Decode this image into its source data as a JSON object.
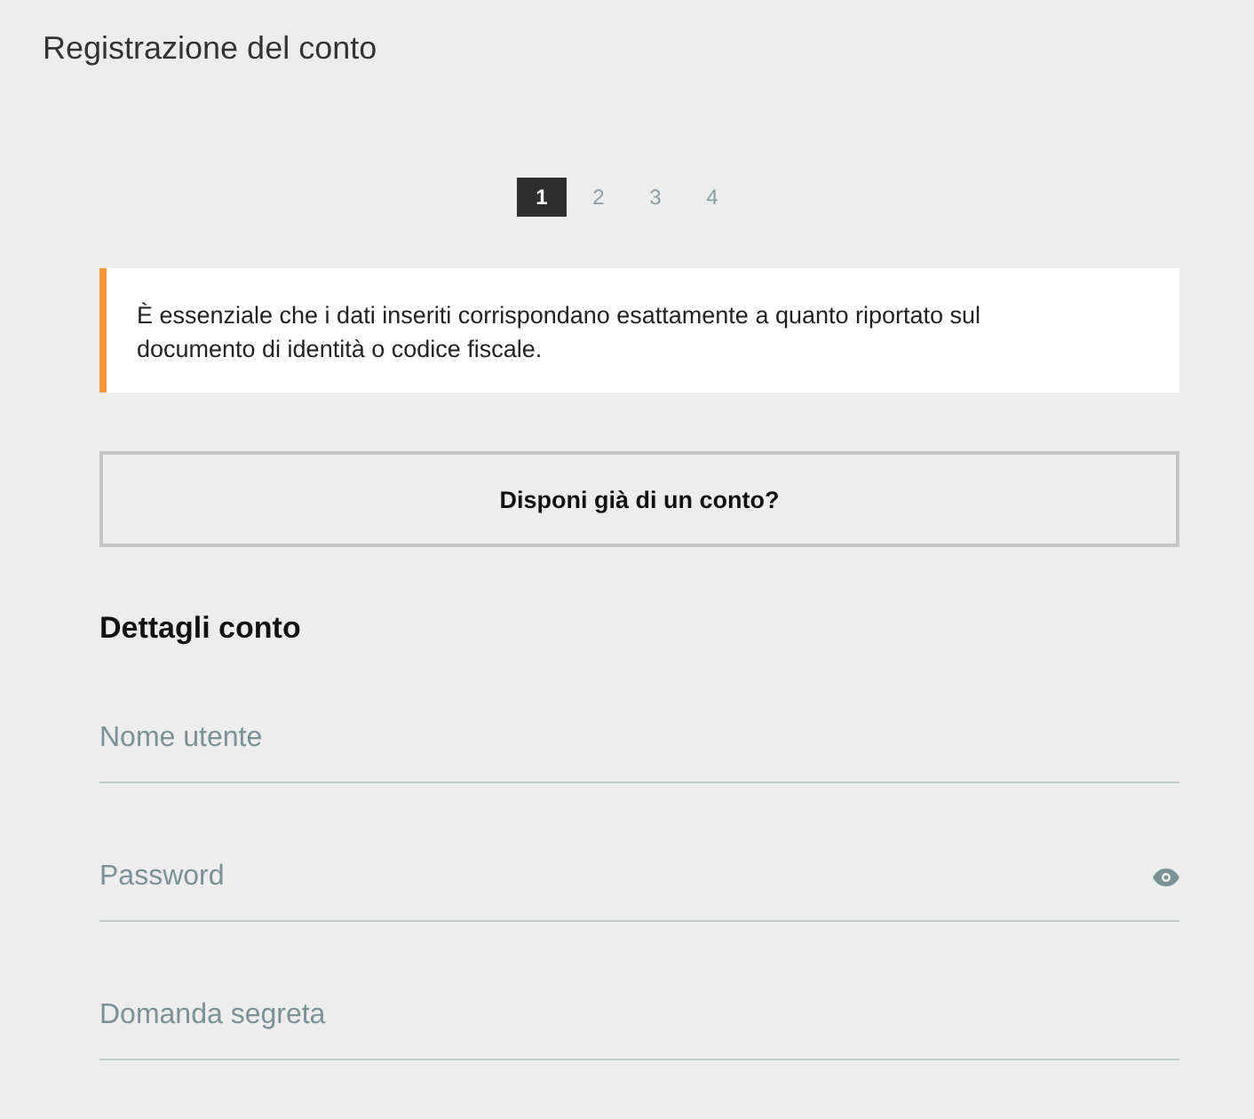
{
  "page": {
    "title": "Registrazione del conto"
  },
  "steps": [
    {
      "label": "1",
      "selected": true
    },
    {
      "label": "2",
      "selected": false
    },
    {
      "label": "3",
      "selected": false
    },
    {
      "label": "4",
      "selected": false
    }
  ],
  "notice": {
    "text": "È essenziale che i dati inseriti corrispondano esattamente a quanto riportato sul documento di identità o codice fiscale."
  },
  "login_button": {
    "label": "Disponi già di un conto?"
  },
  "section": {
    "title": "Dettagli conto"
  },
  "fields": [
    {
      "kind": "text",
      "placeholder": "Nome utente"
    },
    {
      "kind": "password",
      "placeholder": "Password"
    },
    {
      "kind": "text",
      "placeholder": "Domanda segreta"
    }
  ]
}
